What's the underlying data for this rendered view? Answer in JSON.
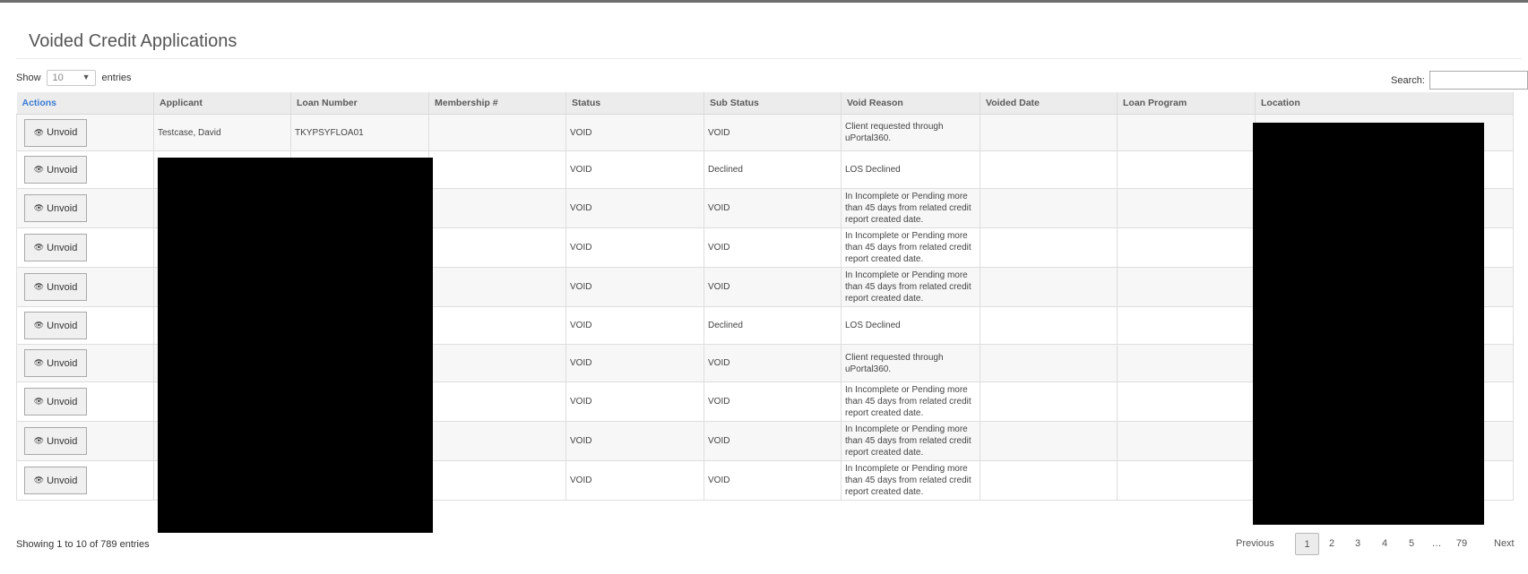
{
  "page": {
    "title": "Voided Credit Applications"
  },
  "length_control": {
    "show_label": "Show",
    "value": "10",
    "entries_label": "entries"
  },
  "search": {
    "label": "Search:",
    "value": ""
  },
  "table": {
    "columns": [
      "Actions",
      "Applicant",
      "Loan Number",
      "Membership #",
      "Status",
      "Sub Status",
      "Void Reason",
      "Voided Date",
      "Loan Program",
      "Location"
    ],
    "unvoid_label": "Unvoid",
    "rows": [
      {
        "applicant": "Testcase, David",
        "loan_number": "TKYPSYFLOA01",
        "membership": "",
        "status": "VOID",
        "sub_status": "VOID",
        "void_reason": "Client requested through uPortal360.",
        "voided_date": "",
        "loan_program": "",
        "location": ""
      },
      {
        "applicant": "",
        "loan_number": "",
        "membership": "",
        "status": "VOID",
        "sub_status": "Declined",
        "void_reason": "LOS Declined",
        "voided_date": "",
        "loan_program": "",
        "location": ""
      },
      {
        "applicant": "",
        "loan_number": "",
        "membership": "",
        "status": "VOID",
        "sub_status": "VOID",
        "void_reason": "In Incomplete or Pending more than 45 days from related credit report created date.",
        "voided_date": "",
        "loan_program": "",
        "location": ""
      },
      {
        "applicant": "",
        "loan_number": "",
        "membership": "",
        "status": "VOID",
        "sub_status": "VOID",
        "void_reason": "In Incomplete or Pending more than 45 days from related credit report created date.",
        "voided_date": "",
        "loan_program": "",
        "location": ""
      },
      {
        "applicant": "",
        "loan_number": "",
        "membership": "",
        "status": "VOID",
        "sub_status": "VOID",
        "void_reason": "In Incomplete or Pending more than 45 days from related credit report created date.",
        "voided_date": "",
        "loan_program": "",
        "location": ""
      },
      {
        "applicant": "",
        "loan_number": "",
        "membership": "",
        "status": "VOID",
        "sub_status": "Declined",
        "void_reason": "LOS Declined",
        "voided_date": "",
        "loan_program": "",
        "location": ""
      },
      {
        "applicant": "",
        "loan_number": "",
        "membership": "",
        "status": "VOID",
        "sub_status": "VOID",
        "void_reason": "Client requested through uPortal360.",
        "voided_date": "",
        "loan_program": "",
        "location": ""
      },
      {
        "applicant": "",
        "loan_number": "",
        "membership": "",
        "status": "VOID",
        "sub_status": "VOID",
        "void_reason": "In Incomplete or Pending more than 45 days from related credit report created date.",
        "voided_date": "",
        "loan_program": "",
        "location": ""
      },
      {
        "applicant": "",
        "loan_number": "",
        "membership": "",
        "status": "VOID",
        "sub_status": "VOID",
        "void_reason": "In Incomplete or Pending more than 45 days from related credit report created date.",
        "voided_date": "",
        "loan_program": "",
        "location": ""
      },
      {
        "applicant": "",
        "loan_number": "",
        "membership": "",
        "status": "VOID",
        "sub_status": "VOID",
        "void_reason": "In Incomplete or Pending more than 45 days from related credit report created date.",
        "voided_date": "",
        "loan_program": "",
        "location": ""
      }
    ]
  },
  "footer": {
    "info": "Showing 1 to 10 of 789 entries",
    "pagination": {
      "previous": "Previous",
      "pages": [
        "1",
        "2",
        "3",
        "4",
        "5",
        "…",
        "79"
      ],
      "current": "1",
      "next": "Next"
    }
  },
  "icons": {
    "unvoid_icon": "eye-icon",
    "select_caret": "caret-down-icon"
  }
}
